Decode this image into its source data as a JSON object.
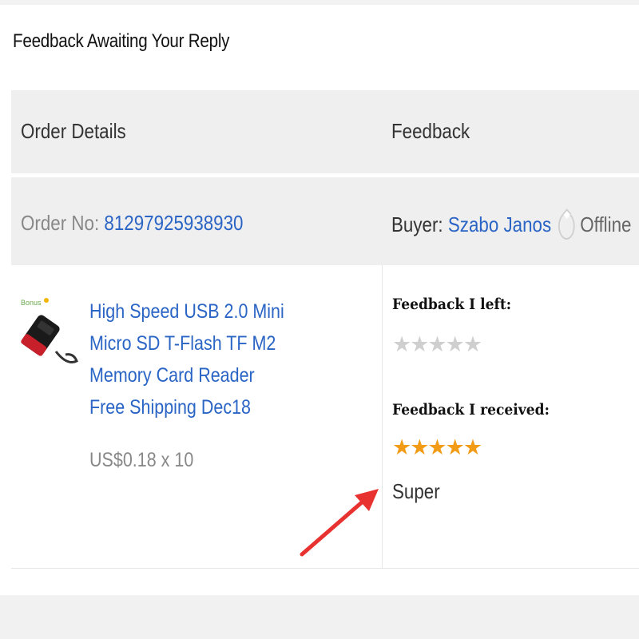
{
  "page": {
    "title": "Feedback Awaiting Your Reply"
  },
  "table": {
    "headers": {
      "order_details": "Order Details",
      "feedback": "Feedback"
    },
    "order": {
      "order_no_label": "Order No:",
      "order_no": "81297925938930",
      "buyer_label": "Buyer:",
      "buyer_name": "Szabo Janos",
      "buyer_status": "Offline"
    },
    "product": {
      "title": "High Speed USB 2.0 Mini Micro SD T-Flash TF M2 Memory Card Reader Free Shipping Dec18",
      "price": "US$0.18 x 10",
      "thumbnail_icon": "card-reader-thumbnail"
    },
    "feedback": {
      "left_label": "Feedback I left:",
      "left_stars": "★★★★★",
      "left_rating": 0,
      "received_label": "Feedback I received:",
      "received_stars": "★★★★★",
      "received_rating": 5,
      "received_comment": "Super"
    }
  },
  "colors": {
    "link": "#2a64c5",
    "star_active": "#f29b16",
    "star_inactive": "#cfcfcf",
    "arrow": "#e8322f"
  }
}
